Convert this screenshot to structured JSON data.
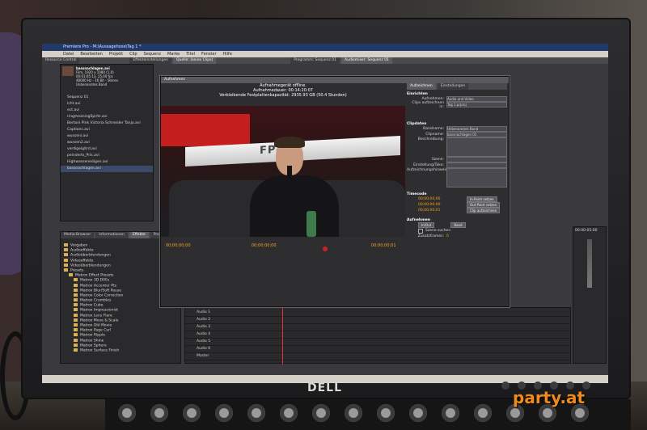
{
  "window": {
    "title": "Premiere Pro - M:\\Aussagehose\\Tag 1 *"
  },
  "menus": [
    "Datei",
    "Bearbeiten",
    "Projekt",
    "Clip",
    "Sequenz",
    "Marke",
    "Titel",
    "Fenster",
    "Hilfe"
  ],
  "tabs_top": [
    "Resource Central",
    "Effekteinstellungen",
    "Quelle: (keine Clips)",
    "Programm: Sequenz 01",
    "Audiomixer: Sequenz 01"
  ],
  "project": {
    "clip_name": "bassnachlagen.avi",
    "clip_info": [
      "Film, 1920 x 1080 (1,0)",
      "00:01:05:13, 25,00 fps",
      "48000 Hz - 16 Bit - Stereo",
      "Unbenanntes Band"
    ],
    "files": [
      "Sequenz 01",
      "icht.avi",
      "ect.avi",
      "ringmeaningSpirts.avi",
      "Bertoni Pink Victoria Schneider Tanja.avi",
      "Captions.avi",
      "wusseni.avi",
      "wussen2.avi",
      "verdigeigitrd.avi",
      "peinderts_Pris.avi",
      "Highwassenedigen.avi",
      "bassnachlagen.avi"
    ]
  },
  "effects": {
    "tabs": [
      "Media-Browser",
      "Informationen",
      "Effekte",
      "Protokoll"
    ],
    "tree": [
      "Vorgaben",
      "Audioeffekte",
      "Audioüberblendungen",
      "Videoeffekte",
      "Videoüberblendungen",
      "Presets",
      "Matrox Effect Presets",
      "Matrox 3D DVEs",
      "Matrox Accenter Pts",
      "Matrox Blur/Soft Pause",
      "Matrox Color Correction",
      "Matrox Crumbles",
      "Matrox Cube",
      "Matrox Impressionist",
      "Matrox Lens Flare",
      "Matrox Move & Scale",
      "Matrox Old Movie",
      "Matrox Page Curl",
      "Matrox Ripple",
      "Matrox Shine",
      "Matrox Sphere",
      "Matrox Surface Finish"
    ]
  },
  "timeline": {
    "tracks": [
      "Audio 1",
      "Audio 2",
      "Audio 3",
      "Audio 4",
      "Audio 5",
      "Audio 6",
      "Master"
    ],
    "timecode": "00:00:05:00"
  },
  "capture": {
    "tabs": [
      "Aufnehmen"
    ],
    "status_lines": [
      "Aufnahmegerät offline.",
      "Aufnahmedauer: 00:14:20:07",
      "Verbleibende Festplattenkapazität: 2935.93 GB (50.4 Stunden)"
    ],
    "timecodes": [
      "00;00;00;00",
      "00;00;00;00",
      "00;00;00;01"
    ],
    "side": {
      "tabs": [
        "Aufzeichnen",
        "Einstellungen"
      ],
      "setup_title": "Einrichten",
      "record_label": "Aufnehmen:",
      "record_value": "Audio und Video",
      "clips_label": "Clips aufzeichnen in:",
      "clips_value": "Tag 1.prproj",
      "clipdata_title": "Clipdaten",
      "fields": [
        "Bandname:",
        "Clipname:",
        "Beschreibung:",
        "Szene:",
        "Einstellung/Take:",
        "Aufzeichnungshinweis:"
      ],
      "bandname_value": "Unbenanntes Band",
      "clipname_value": "bassnachlagen 01",
      "timecode_title": "Timecode",
      "timecode_rows": [
        {
          "tc": "00;00;00;00",
          "btn": "In-Point setzen"
        },
        {
          "tc": "00;00;00;00",
          "btn": "Out-Point setzen"
        },
        {
          "tc": "00;00;00;01",
          "btn": "Clip aufzeichnen"
        }
      ],
      "capture_title": "Aufnehmen",
      "in_out": [
        "In/Out",
        "Band"
      ],
      "scene_search": "Szene suchen",
      "handles_label": "Zusatzframes:",
      "handles_value": "0"
    }
  },
  "video": {
    "banner_text": "FP-4"
  },
  "monitor": {
    "brand": "DELL"
  },
  "watermark": {
    "text": "party.at"
  }
}
